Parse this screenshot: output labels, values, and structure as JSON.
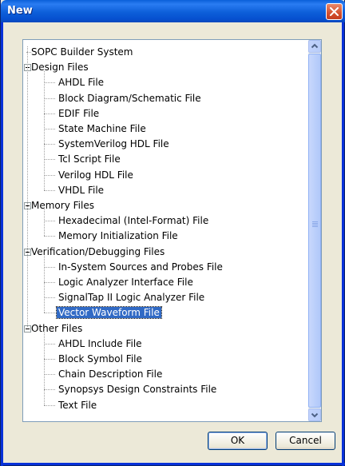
{
  "window": {
    "title": "New"
  },
  "tree": [
    {
      "label": "SOPC Builder System",
      "level": 0,
      "leaf": true
    },
    {
      "label": "Design Files",
      "level": 0,
      "leaf": false
    },
    {
      "label": "AHDL File",
      "level": 1,
      "leaf": true
    },
    {
      "label": "Block Diagram/Schematic File",
      "level": 1,
      "leaf": true
    },
    {
      "label": "EDIF File",
      "level": 1,
      "leaf": true
    },
    {
      "label": "State Machine File",
      "level": 1,
      "leaf": true
    },
    {
      "label": "SystemVerilog HDL File",
      "level": 1,
      "leaf": true
    },
    {
      "label": "Tcl Script File",
      "level": 1,
      "leaf": true
    },
    {
      "label": "Verilog HDL File",
      "level": 1,
      "leaf": true
    },
    {
      "label": "VHDL File",
      "level": 1,
      "leaf": true
    },
    {
      "label": "Memory Files",
      "level": 0,
      "leaf": false
    },
    {
      "label": "Hexadecimal (Intel-Format) File",
      "level": 1,
      "leaf": true
    },
    {
      "label": "Memory Initialization File",
      "level": 1,
      "leaf": true
    },
    {
      "label": "Verification/Debugging Files",
      "level": 0,
      "leaf": false
    },
    {
      "label": "In-System Sources and Probes File",
      "level": 1,
      "leaf": true
    },
    {
      "label": "Logic Analyzer Interface File",
      "level": 1,
      "leaf": true
    },
    {
      "label": "SignalTap II Logic Analyzer File",
      "level": 1,
      "leaf": true
    },
    {
      "label": "Vector Waveform File",
      "level": 1,
      "leaf": true,
      "selected": true
    },
    {
      "label": "Other Files",
      "level": 0,
      "leaf": false
    },
    {
      "label": "AHDL Include File",
      "level": 1,
      "leaf": true
    },
    {
      "label": "Block Symbol File",
      "level": 1,
      "leaf": true
    },
    {
      "label": "Chain Description File",
      "level": 1,
      "leaf": true
    },
    {
      "label": "Synopsys Design Constraints File",
      "level": 1,
      "leaf": true
    },
    {
      "label": "Text File",
      "level": 1,
      "leaf": true
    }
  ],
  "buttons": {
    "ok": "OK",
    "cancel": "Cancel"
  },
  "colors": {
    "titlebar": "#0a5fd8",
    "selection": "#316ac5",
    "dialog": "#ece9d8"
  }
}
